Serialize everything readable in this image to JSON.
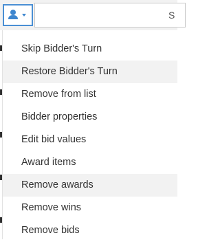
{
  "toolbar": {
    "user_button_icon": "user-icon",
    "dropdown_icon": "caret-down-icon",
    "search_text": "S",
    "accent_color": "#4a8fd4"
  },
  "menu": {
    "items": [
      {
        "label": "Skip Bidder's Turn",
        "highlighted": false
      },
      {
        "label": "Restore Bidder's Turn",
        "highlighted": true
      },
      {
        "label": "Remove from list",
        "highlighted": false
      },
      {
        "label": "Bidder properties",
        "highlighted": false
      },
      {
        "label": "Edit bid values",
        "highlighted": false
      },
      {
        "label": "Award items",
        "highlighted": false
      },
      {
        "label": "Remove awards",
        "highlighted": true
      },
      {
        "label": "Remove wins",
        "highlighted": false
      },
      {
        "label": "Remove bids",
        "highlighted": false
      }
    ]
  }
}
